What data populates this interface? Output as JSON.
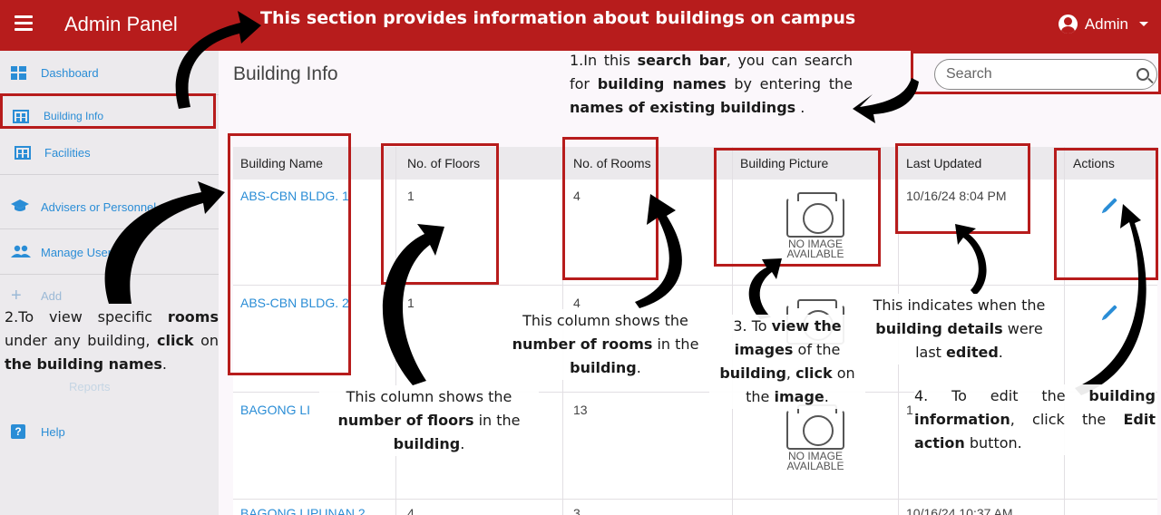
{
  "header": {
    "title": "Admin Panel",
    "banner_note": "This section provides information about buildings on campus",
    "user_label": "Admin"
  },
  "sidebar": {
    "items": [
      {
        "label": "Dashboard",
        "icon": "dashboard-icon"
      },
      {
        "label": "Building Info",
        "icon": "building-icon"
      },
      {
        "label": "Facilities",
        "icon": "building-icon"
      },
      {
        "label": "Advisers or Personnel",
        "icon": "graduation-cap-icon"
      },
      {
        "label": "Manage User",
        "icon": "people-icon"
      },
      {
        "label": "Add",
        "icon": "plus-icon"
      },
      {
        "label": "Reports",
        "icon": "report-icon"
      },
      {
        "label": "Help",
        "icon": "help-icon"
      }
    ]
  },
  "main": {
    "page_title": "Building Info",
    "search": {
      "placeholder": "Search",
      "value": ""
    }
  },
  "table": {
    "columns": [
      "Building Name",
      "No. of Floors",
      "No. of Rooms",
      "Building Picture",
      "Last Updated",
      "Actions"
    ],
    "rows": [
      {
        "name": "ABS-CBN BLDG. 1",
        "floors": "1",
        "rooms": "4",
        "picture": "NO IMAGE AVAILABLE",
        "updated": "10/16/24 8:04 PM"
      },
      {
        "name": "ABS-CBN BLDG. 2",
        "floors": "1",
        "rooms": "4",
        "picture": "NO IMAGE AVAILABLE",
        "updated": ""
      },
      {
        "name": "BAGONG LI",
        "floors": "",
        "rooms": "13",
        "picture": "NO IMAGE AVAILABLE",
        "updated": "1"
      },
      {
        "name": "BAGONG LIPUNAN 2",
        "floors": "4",
        "rooms": "3",
        "picture": "",
        "updated": "10/16/24 10:37 AM"
      }
    ],
    "no_image_line1": "NO IMAGE",
    "no_image_line2": "AVAILABLE"
  },
  "annotations": {
    "search": {
      "p1": "1.In this ",
      "b1": "search bar",
      "p2": ", you can search for ",
      "b2": "building names",
      "p3": " by entering the ",
      "b3": "names of existing buildings",
      "p4": " ."
    },
    "rooms_view": {
      "p1": "2.To view specific ",
      "b1": "rooms",
      "p2": " under any building, ",
      "b2": "click",
      "p3": " on ",
      "b3": "the building names",
      "p4": "."
    },
    "floors": {
      "p1": "This column shows the ",
      "b1": "number of floors",
      "p2": " in the ",
      "b2": "building",
      "p3": "."
    },
    "rooms": {
      "p1": "This column shows the ",
      "b1": "number of rooms",
      "p2": " in the ",
      "b2": "building",
      "p3": "."
    },
    "images": {
      "p1": "3. To ",
      "b1": "view the images",
      "p2": " of the ",
      "b2": "building",
      "p3": ", ",
      "b3": "click",
      "p4": " on the ",
      "b4": "image",
      "p5": "."
    },
    "updated": {
      "p1": "This indicates when the ",
      "b1": "building details",
      "p2": " were last ",
      "b2": "edited",
      "p3": "."
    },
    "edit": {
      "p1": "4. To edit the ",
      "b1": "building information",
      "p2": ", click the ",
      "b2": "Edit action",
      "p3": " button."
    }
  },
  "colors": {
    "primary": "#b71c1c",
    "link": "#2a8dd6",
    "sidebar_bg": "#eceaed"
  }
}
